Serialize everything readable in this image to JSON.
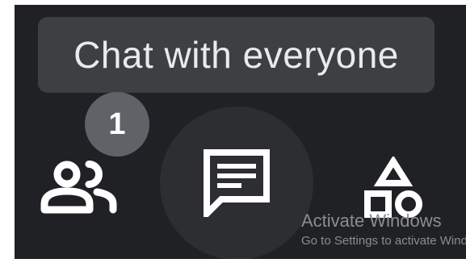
{
  "tooltip": {
    "text": "Chat with everyone"
  },
  "toolbar": {
    "people": {
      "icon": "people-icon",
      "badge_count": "1"
    },
    "chat": {
      "icon": "chat-icon"
    },
    "activities": {
      "icon": "shapes-icon"
    }
  },
  "watermark": {
    "title": "Activate Windows",
    "subtitle": "Go to Settings to activate Windows."
  },
  "colors": {
    "background": "#202124",
    "tooltip_bg": "#3c4043",
    "badge_bg": "#5f6368",
    "icon": "#ffffff",
    "chat_button_bg": "#2d2e31"
  }
}
